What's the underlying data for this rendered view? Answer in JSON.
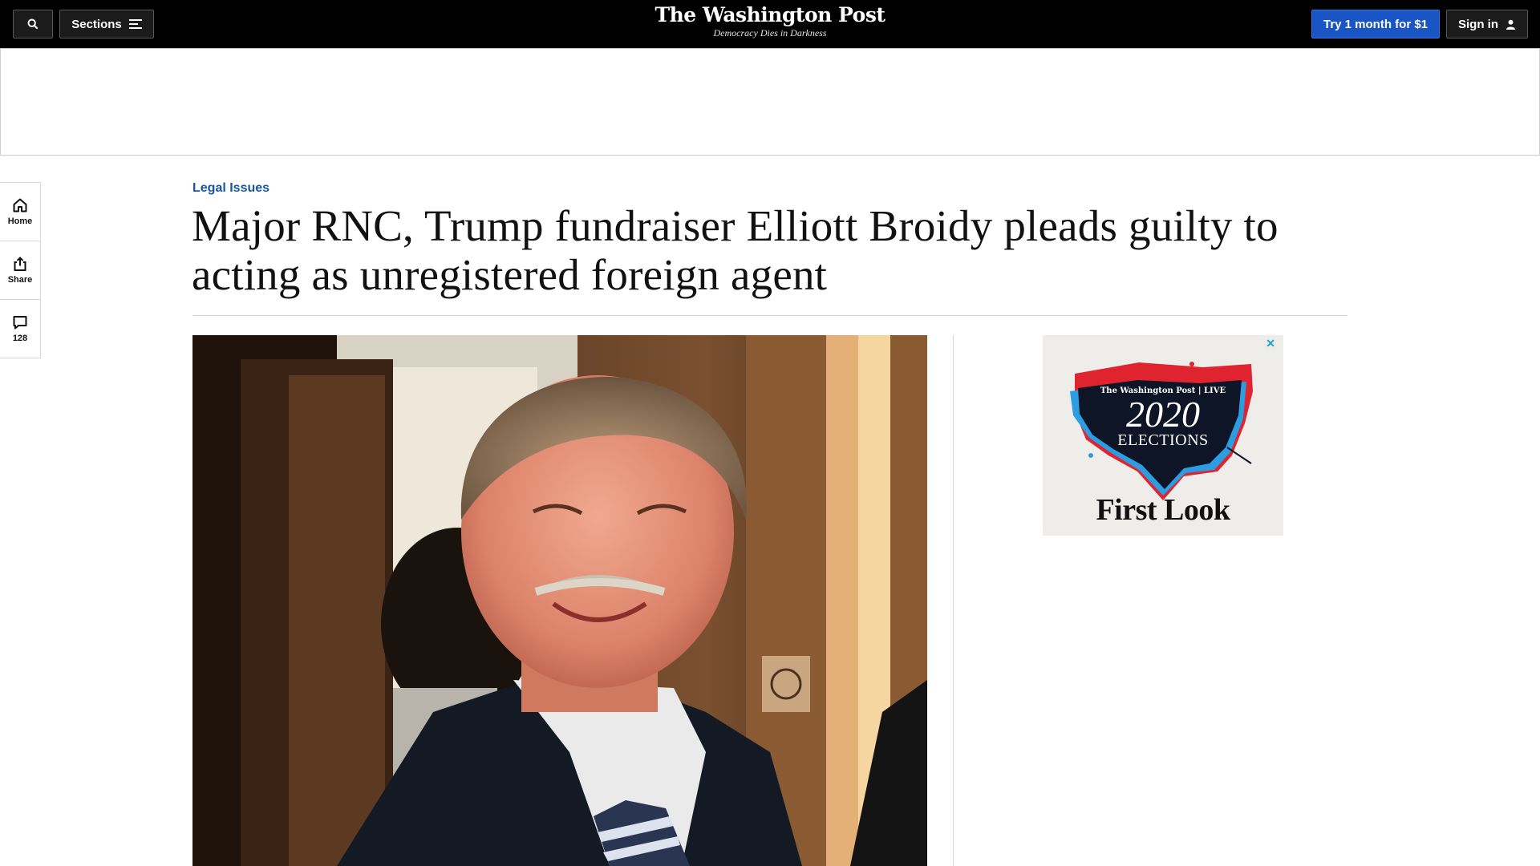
{
  "nav": {
    "sections_label": "Sections",
    "try_label": "Try 1 month for $1",
    "signin_label": "Sign in",
    "logo_text": "The Washington Post",
    "tagline": "Democracy Dies in Darkness"
  },
  "rail": {
    "home_label": "Home",
    "share_label": "Share",
    "comments_count": "128"
  },
  "article": {
    "kicker": "Legal Issues",
    "headline": "Major RNC, Trump fundraiser Elliott Broidy pleads guilty to acting as unregistered foreign agent"
  },
  "promo": {
    "close_glyph": "✕",
    "brand": "The Washington Post | LIVE",
    "year": "2020",
    "elections": "ELECTIONS",
    "first_look": "First Look"
  },
  "icons": {
    "search": "search-icon",
    "sections": "menu-icon",
    "signin": "user-icon",
    "home": "home-icon",
    "share": "share-icon",
    "comments": "comment-icon",
    "close": "close-icon"
  },
  "colors": {
    "nav_bg": "#000000",
    "try_button": "#1955c5",
    "kicker": "#1955a5",
    "promo_close": "#18a3d6"
  }
}
